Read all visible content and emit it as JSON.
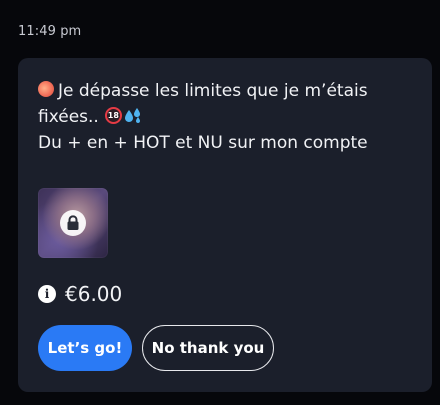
{
  "timestamp": "11:49 pm",
  "message": {
    "line1": "Je dépasse les limites que je m’étais",
    "line2": "fixées..",
    "line3": "Du + en + HOT et NU sur mon compte",
    "emojis": [
      "peach",
      "no-one-under-eighteen",
      "sweat-droplets"
    ],
    "no18_label": "18"
  },
  "media": {
    "icon": "lock-icon"
  },
  "price": {
    "icon": "info-icon",
    "info_glyph": "i",
    "value": "€6.00"
  },
  "buttons": {
    "accept_label": "Let’s go!",
    "decline_label": "No thank you"
  },
  "colors": {
    "background": "#06070b",
    "card": "#1b1f2b",
    "primary": "#2a7af5"
  }
}
